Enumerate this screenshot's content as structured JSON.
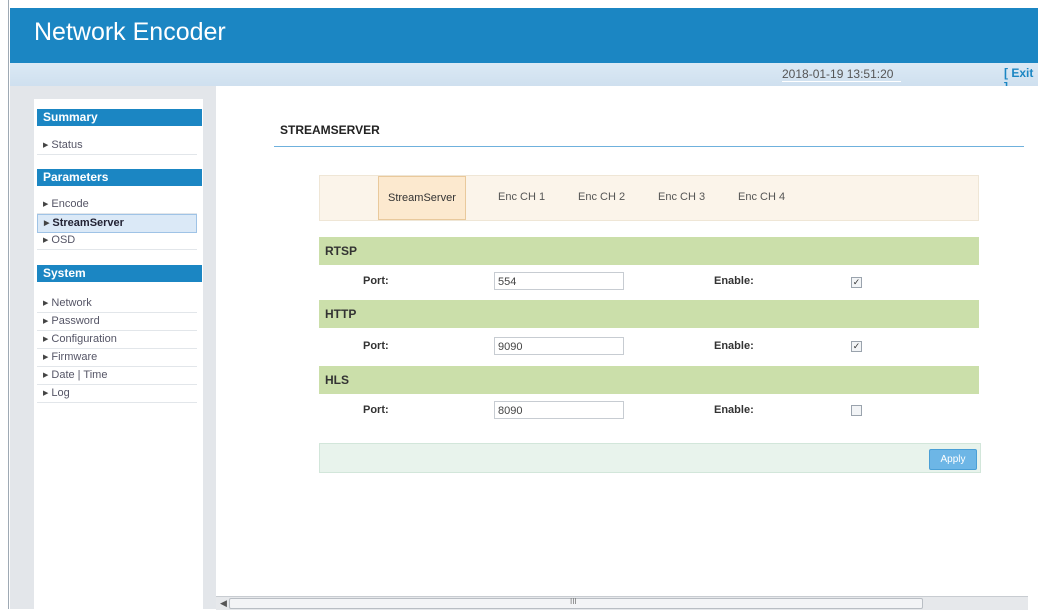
{
  "app": {
    "title": "Network Encoder"
  },
  "topbar": {
    "datetime": "2018-01-19 13:51:20",
    "exit_label": "[ Exit ]"
  },
  "sidebar": {
    "sections": [
      {
        "heading": "Summary",
        "items": [
          {
            "label": "Status",
            "active": false
          }
        ]
      },
      {
        "heading": "Parameters",
        "items": [
          {
            "label": "Encode",
            "active": false
          },
          {
            "label": "StreamServer",
            "active": true
          },
          {
            "label": "OSD",
            "active": false
          }
        ]
      },
      {
        "heading": "System",
        "items": [
          {
            "label": "Network",
            "active": false
          },
          {
            "label": "Password",
            "active": false
          },
          {
            "label": "Configuration",
            "active": false
          },
          {
            "label": "Firmware",
            "active": false
          },
          {
            "label": "Date | Time",
            "active": false
          },
          {
            "label": "Log",
            "active": false
          }
        ]
      }
    ]
  },
  "main": {
    "page_title": "STREAMSERVER",
    "tabs": [
      {
        "label": "StreamServer",
        "active": true
      },
      {
        "label": "Enc CH 1",
        "active": false
      },
      {
        "label": "Enc CH 2",
        "active": false
      },
      {
        "label": "Enc CH 3",
        "active": false
      },
      {
        "label": "Enc CH 4",
        "active": false
      }
    ],
    "sections": [
      {
        "name": "RTSP",
        "port_label": "Port:",
        "port_value": "554",
        "enable_label": "Enable:",
        "enabled": true
      },
      {
        "name": "HTTP",
        "port_label": "Port:",
        "port_value": "9090",
        "enable_label": "Enable:",
        "enabled": true
      },
      {
        "name": "HLS",
        "port_label": "Port:",
        "port_value": "8090",
        "enable_label": "Enable:",
        "enabled": false
      }
    ],
    "apply_label": "Apply"
  },
  "icons": {
    "side_arrow": "triangle-right-icon",
    "checkbox_checked": "check-icon"
  },
  "colors": {
    "header": "#1b86c3",
    "section_bar": "#cbdfaa",
    "active_tab": "#fce9cf",
    "apply_button": "#6db6e6"
  }
}
